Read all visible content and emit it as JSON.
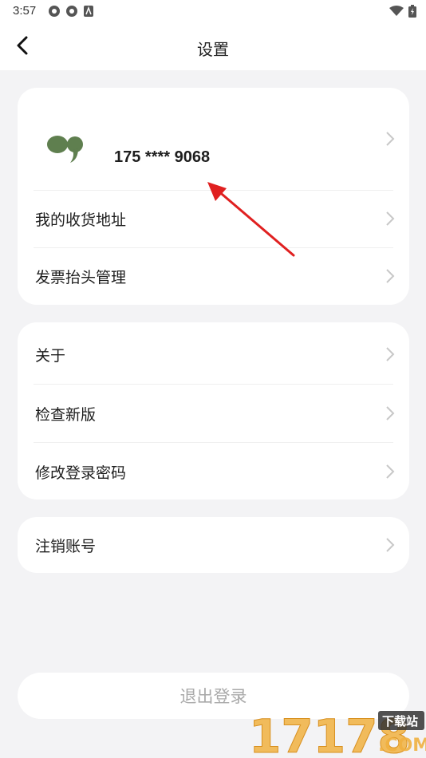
{
  "status_bar": {
    "time": "3:57",
    "icons": [
      "vpn-key-icon",
      "vpn-key-icon",
      "app-notification-icon",
      "wifi-icon",
      "battery-charging-icon"
    ]
  },
  "header": {
    "title": "设置",
    "back_icon": "back-arrow-icon"
  },
  "account": {
    "phone": "175 **** 9068",
    "avatar_icon": "quote-bubble-icon"
  },
  "group1": [
    {
      "label": "我的收货地址"
    },
    {
      "label": "发票抬头管理"
    }
  ],
  "group2": [
    {
      "label": "关于"
    },
    {
      "label": "检查新版"
    },
    {
      "label": "修改登录密码"
    }
  ],
  "group3": [
    {
      "label": "注销账号"
    }
  ],
  "logout": {
    "label": "退出登录"
  },
  "watermark": {
    "number": "17178",
    "tag": "下载站",
    "domain": ".COM"
  },
  "colors": {
    "background": "#f3f3f5",
    "card": "#ffffff",
    "avatar": "#5f7f4f",
    "annotation_arrow": "#e02020",
    "watermark": "#f0b040"
  }
}
